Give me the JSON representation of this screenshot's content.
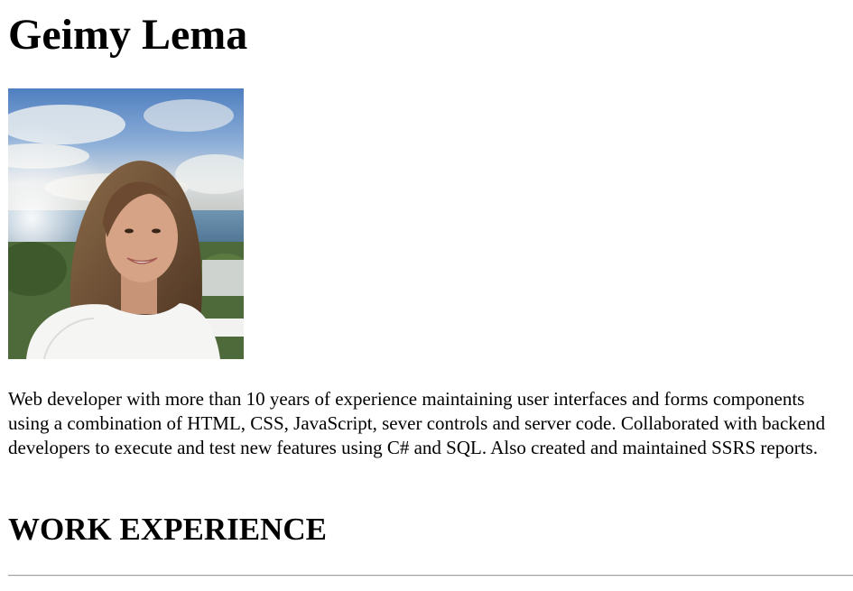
{
  "page": {
    "title": "Geimy Lema",
    "photo": {
      "description": "portrait-photo"
    },
    "bio": "Web developer with more than 10 years of experience maintaining user interfaces and forms components using a combination of HTML, CSS, JavaScript, sever controls and server code. Collaborated with backend developers to execute and test new features using C# and SQL. Also created and maintained SSRS reports.",
    "sections": [
      {
        "heading": "WORK EXPERIENCE"
      }
    ]
  },
  "colors": {
    "text": "#000000",
    "background": "#ffffff",
    "divider": "#9e9e9e"
  }
}
